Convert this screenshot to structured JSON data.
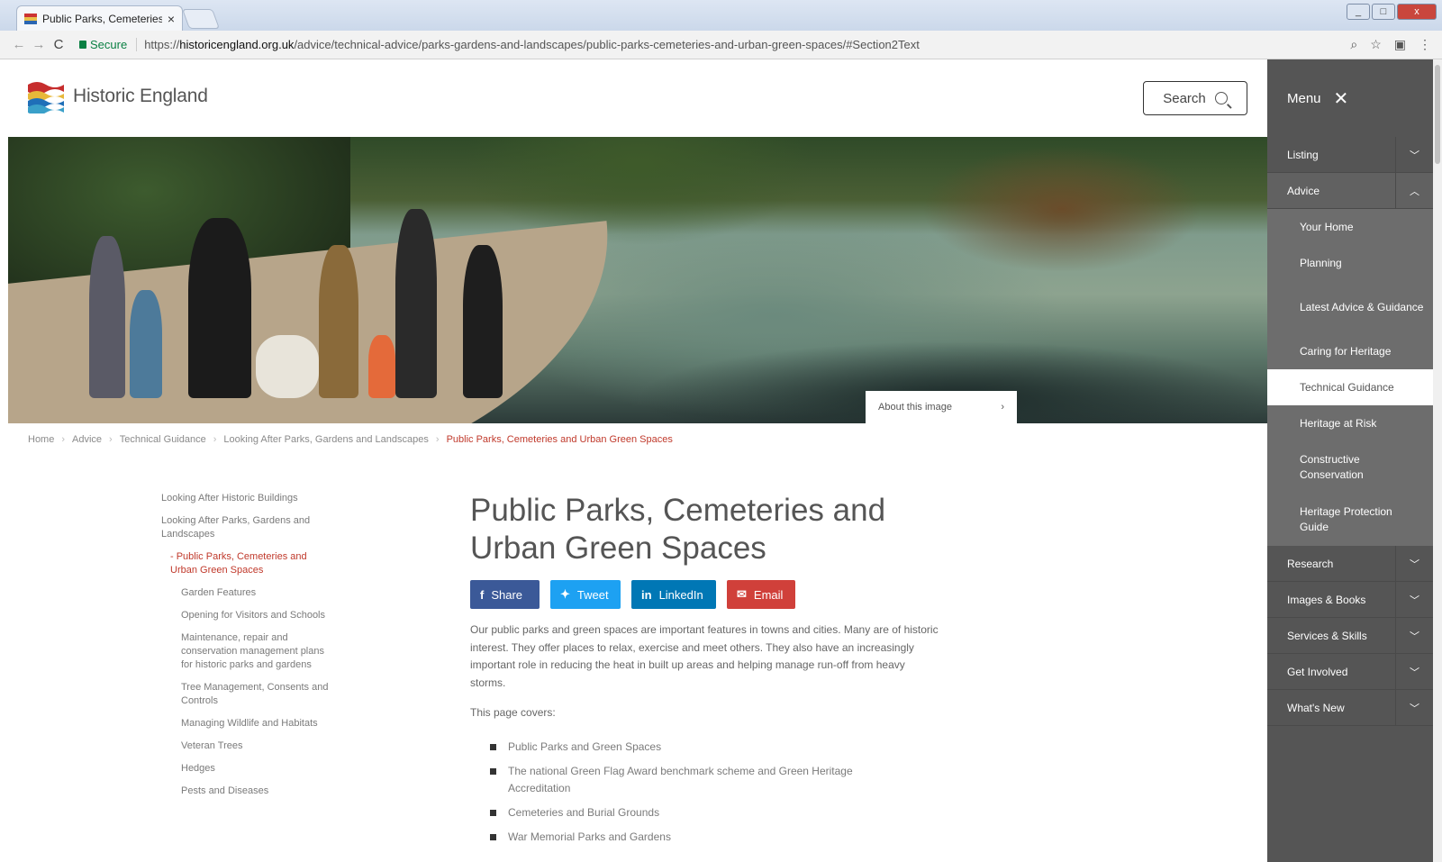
{
  "browser": {
    "tab_title": "Public Parks, Cemeteries",
    "tab_close": "×",
    "secure_label": "Secure",
    "url_scheme": "https://",
    "url_host": "historicengland.org.uk",
    "url_path": "/advice/technical-advice/parks-gardens-and-landscapes/public-parks-cemeteries-and-urban-green-spaces/#Section2Text",
    "back": "←",
    "forward": "→",
    "reload": "C",
    "zoom_icon": "⌕",
    "star_icon": "☆",
    "ext_icon": "▣",
    "more_icon": "⋮"
  },
  "header": {
    "logo_text": "Historic England",
    "search_label": "Search"
  },
  "hero": {
    "about_label": "About this image",
    "about_chevron": "›"
  },
  "breadcrumb": [
    {
      "label": "Home"
    },
    {
      "label": "Advice"
    },
    {
      "label": "Technical Guidance"
    },
    {
      "label": "Looking After Parks, Gardens and Landscapes"
    },
    {
      "label": "Public Parks, Cemeteries and Urban Green Spaces",
      "current": true
    }
  ],
  "leftnav": {
    "items": [
      "Looking After Historic Buildings",
      "Looking After Parks, Gardens and Landscapes",
      "- Public Parks, Cemeteries and Urban Green Spaces",
      "Garden Features",
      "Opening for Visitors and Schools",
      "Maintenance, repair and conservation management plans for historic parks and gardens",
      "Tree Management, Consents and Controls",
      "Managing Wildlife and Habitats",
      "Veteran Trees",
      "Hedges",
      "Pests and Diseases"
    ]
  },
  "content": {
    "title": "Public Parks, Cemeteries and Urban Green Spaces",
    "share": {
      "facebook": "Share",
      "twitter": "Tweet",
      "linkedin": "LinkedIn",
      "email": "Email"
    },
    "intro": "Our public parks and green spaces are important features in towns and cities. Many are of historic interest. They offer places to relax, exercise and meet others. They also have an increasingly important role in reducing the heat in built up areas and helping manage run-off from heavy storms.",
    "covers_label": "This page covers:",
    "links": [
      "Public Parks and Green Spaces",
      "The national Green Flag Award benchmark scheme and Green Heritage Accreditation",
      "Cemeteries and Burial Grounds",
      "War Memorial Parks and Gardens"
    ]
  },
  "menu": {
    "label": "Menu",
    "close": "✕",
    "items": {
      "listing": "Listing",
      "advice": "Advice",
      "research": "Research",
      "images_books": "Images & Books",
      "services_skills": "Services & Skills",
      "get_involved": "Get Involved",
      "whats_new": "What's New"
    },
    "advice_sub": {
      "your_home": "Your Home",
      "planning": "Planning",
      "latest": "Latest Advice & Guidance",
      "caring": "Caring for Heritage",
      "technical": "Technical Guidance",
      "at_risk": "Heritage at Risk",
      "constructive": "Constructive Conservation",
      "protection": "Heritage Protection Guide"
    },
    "chevron_down": "﹀",
    "chevron_up": "︿"
  },
  "colors": {
    "accent_red": "#c0392b",
    "menu_bg": "#555555",
    "facebook": "#3b5998",
    "twitter": "#1da1f2",
    "linkedin": "#0077b5",
    "email": "#d0403a"
  }
}
